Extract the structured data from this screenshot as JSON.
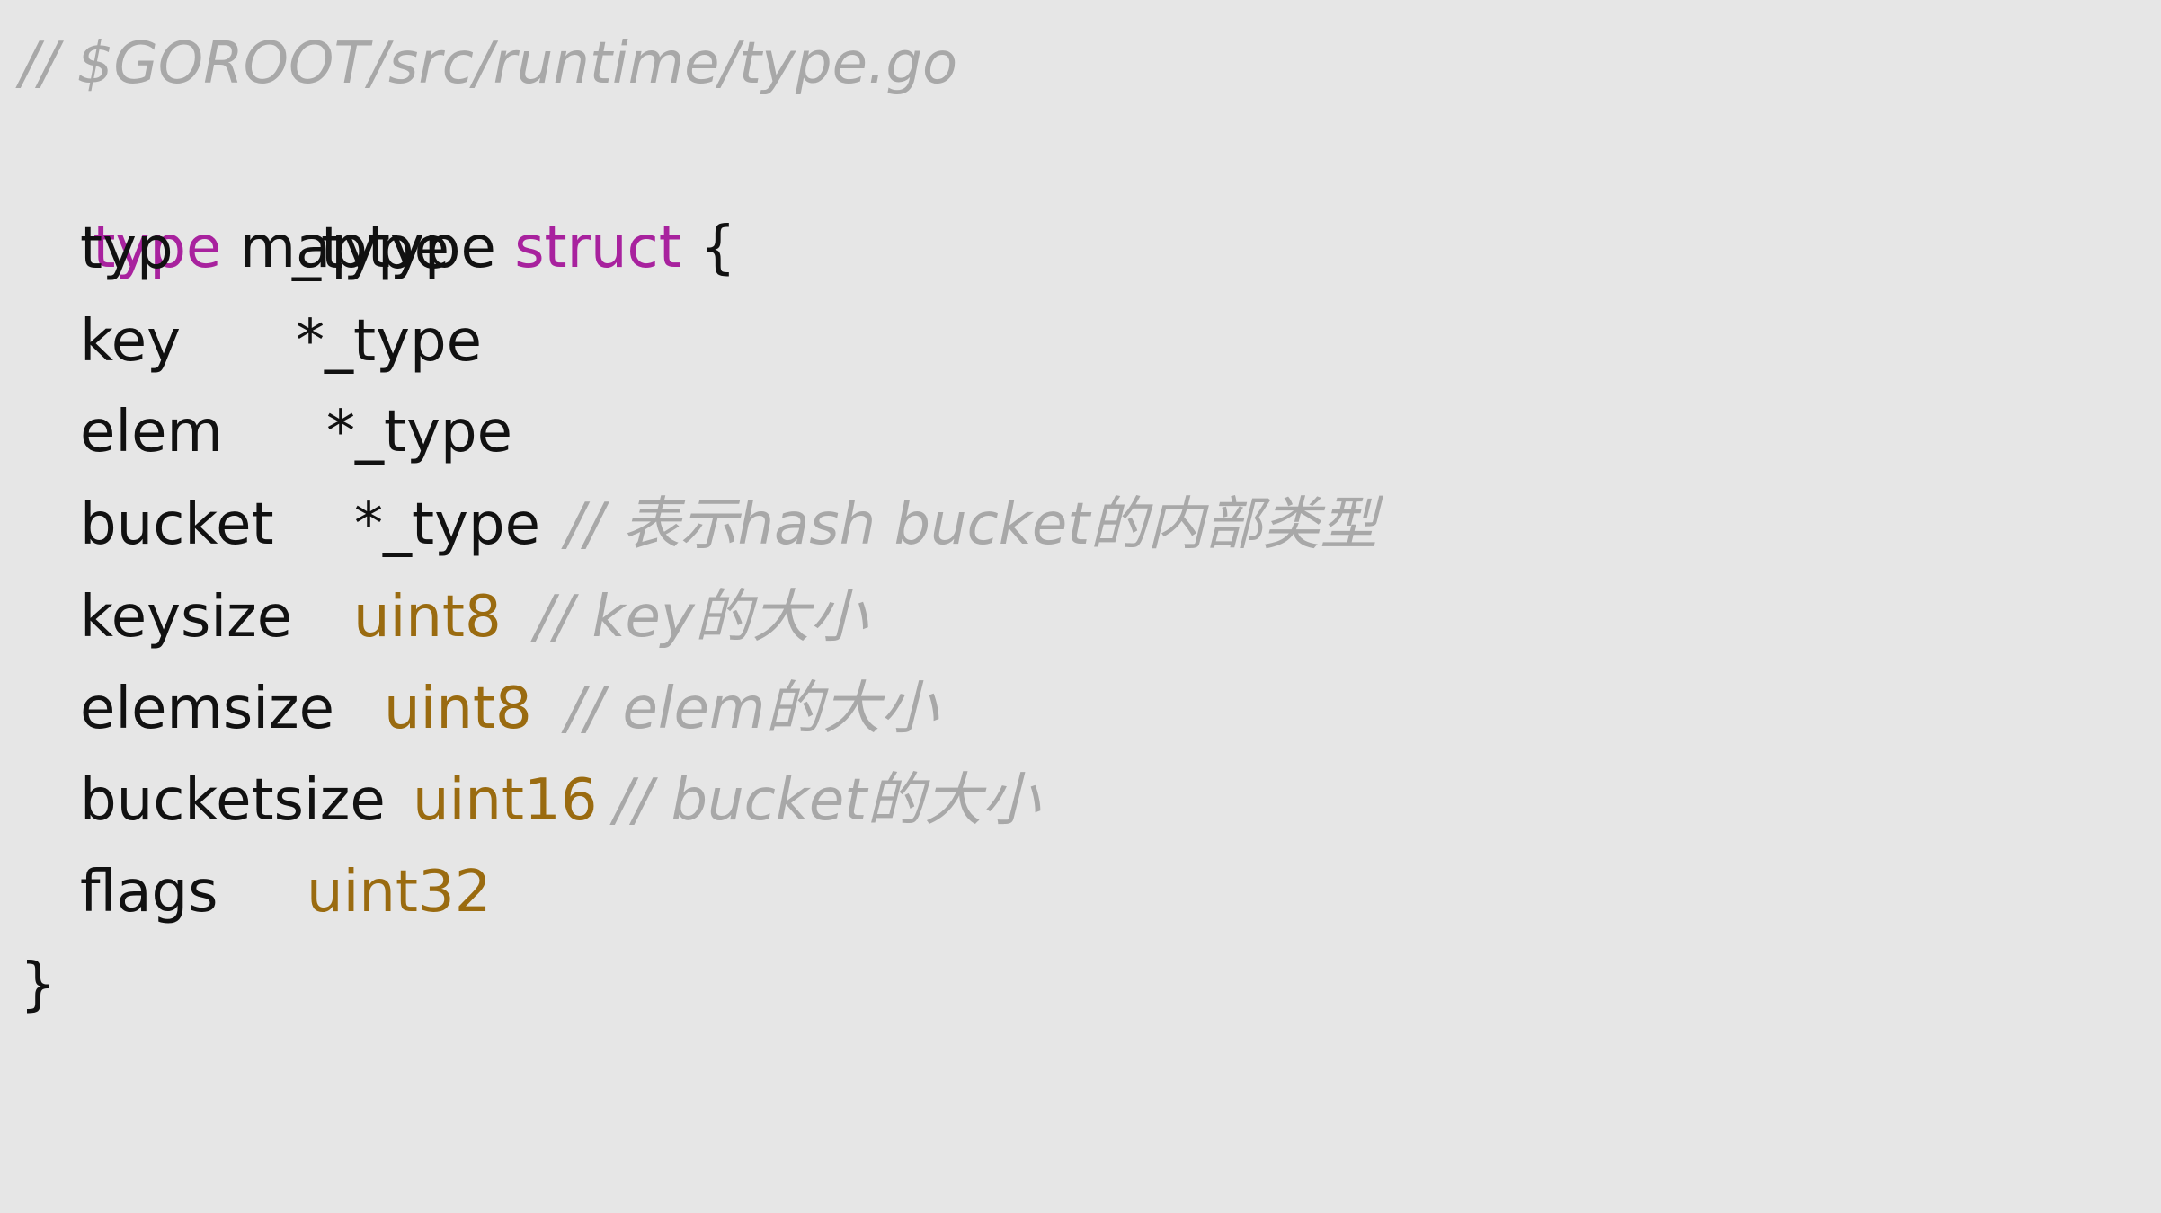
{
  "code": {
    "header_comment": "// $GOROOT/src/runtime/type.go",
    "decl": {
      "kw_type": "type",
      "name": "maptype",
      "kw_struct": "struct",
      "open_brace": "{"
    },
    "fields": [
      {
        "name": "typ",
        "type": "_type",
        "type_kind": "plain",
        "comment": ""
      },
      {
        "name": "key",
        "type": "*_type",
        "type_kind": "plain",
        "comment": ""
      },
      {
        "name": "elem",
        "type": "*_type",
        "type_kind": "plain",
        "comment": ""
      },
      {
        "name": "bucket",
        "type": "*_type",
        "type_kind": "plain",
        "comment": "// 表示hash bucket的内部类型"
      },
      {
        "name": "keysize",
        "type": "uint8",
        "type_kind": "num",
        "comment": "// key的大小"
      },
      {
        "name": "elemsize",
        "type": "uint8",
        "type_kind": "num",
        "comment": "// elem的大小"
      },
      {
        "name": "bucketsize",
        "type": "uint16",
        "type_kind": "num",
        "comment": "// bucket的大小"
      },
      {
        "name": "flags",
        "type": "uint32",
        "type_kind": "num",
        "comment": ""
      }
    ],
    "close_brace": "}"
  },
  "colors": {
    "background": "#e6e6e6",
    "comment": "#a8a8a8",
    "keyword": "#a8229e",
    "numeric_type": "#9a6b10",
    "text": "#111111"
  }
}
